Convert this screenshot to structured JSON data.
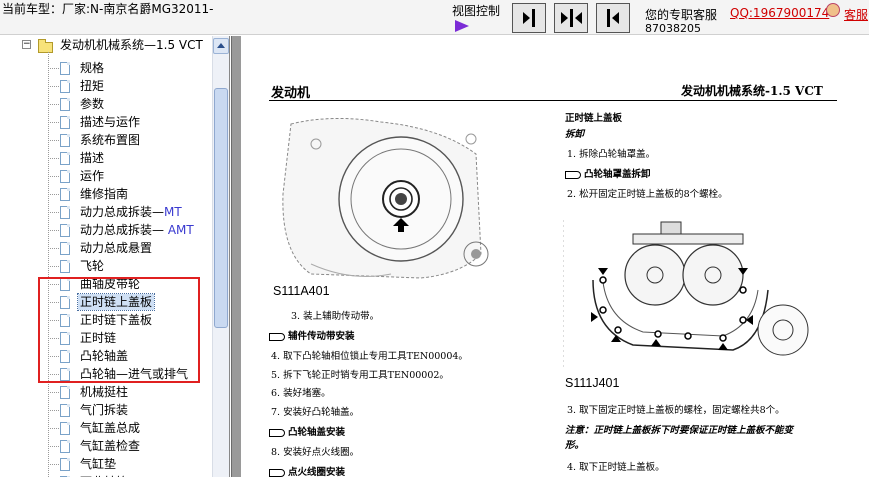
{
  "header": {
    "car_info": "当前车型：厂家:N-南京名爵MG32011-",
    "view_control_label": "视图控制",
    "expert_label": "您的专职客服",
    "qq_label": "QQ:1967900174",
    "phone": "87038205",
    "kefu_label": "客服",
    "view_buttons": [
      "collapse-left",
      "split-view",
      "collapse-right"
    ]
  },
  "sidebar": {
    "root": "发动机机械系统—1.5 VCT",
    "root_expander": "−",
    "items": [
      {
        "label": "规格"
      },
      {
        "label": "扭矩"
      },
      {
        "label": "参数"
      },
      {
        "label": "描述与运作"
      },
      {
        "label": "系统布置图"
      },
      {
        "label": "描述"
      },
      {
        "label": "运作"
      },
      {
        "label": "维修指南"
      },
      {
        "label": "动力总成拆装—",
        "suffix": "MT"
      },
      {
        "label": "动力总成拆装—  ",
        "suffix": "AMT"
      },
      {
        "label": "动力总成悬置"
      },
      {
        "label": "飞轮"
      },
      {
        "label": "曲轴皮带轮"
      },
      {
        "label": "正时链上盖板",
        "selected": true
      },
      {
        "label": "正时链下盖板"
      },
      {
        "label": "正时链"
      },
      {
        "label": "凸轮轴盖"
      },
      {
        "label": "凸轮轴—进气或排气"
      },
      {
        "label": "机械挺柱"
      },
      {
        "label": "气门拆装"
      },
      {
        "label": "气缸盖总成"
      },
      {
        "label": "气缸盖检查"
      },
      {
        "label": "气缸垫"
      },
      {
        "label": "下曲轴箱"
      }
    ]
  },
  "doc": {
    "header_left": "发动机",
    "header_right": "发动机机械系统-1.5  VCT",
    "fig_a_caption": "S111A401",
    "fig_j_caption": "S111J401",
    "left_steps": [
      {
        "num": "3.",
        "text": "装上辅助传动带。"
      },
      {
        "heading": "辅件传动带安装"
      },
      {
        "num": "4.",
        "text": "取下凸轮轴相位锁止专用工具TEN00004。"
      },
      {
        "num": "5.",
        "text": "拆下飞轮正时销专用工具TEN00002。"
      },
      {
        "num": "6.",
        "text": "装好堵塞。"
      },
      {
        "num": "7.",
        "text": "安装好凸轮轴盖。"
      },
      {
        "heading": "凸轮轴盖安装"
      },
      {
        "num": "8.",
        "text": "安装好点火线圈。"
      },
      {
        "heading": "点火线圈安装"
      }
    ],
    "right_title": "正时链上盖板",
    "right_subtitle": "拆卸",
    "right_steps": [
      {
        "num": "1.",
        "text": "拆除凸轮轴罩盖。"
      },
      {
        "heading": "凸轮轴罩盖拆卸"
      },
      {
        "num": "2.",
        "text": "松开固定正时链上盖板的8个螺栓。"
      }
    ],
    "right_steps2": [
      {
        "num": "3.",
        "text": "取下固定正时链上盖板的螺栓，固定螺栓共8个。"
      },
      {
        "note1": "注意：正时链上盖板拆下时要保证正时链上盖板不能变"
      },
      {
        "note2": "形。"
      },
      {
        "num": "4.",
        "text": "取下正时链上盖板。"
      }
    ]
  },
  "colors": {
    "highlight_box": "#e02020",
    "qq_link": "#d00000",
    "arrow": "#7b2bd6"
  }
}
